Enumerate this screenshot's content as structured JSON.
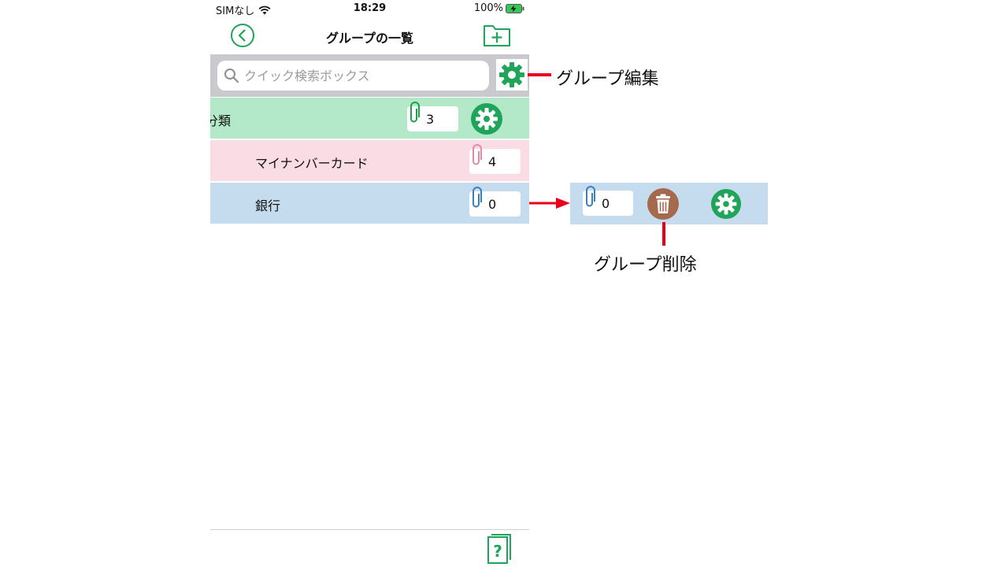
{
  "status_bar": {
    "carrier": "SIMなし",
    "time": "18:29",
    "battery": "100%"
  },
  "nav": {
    "title": "グループの一覧",
    "back_icon": "chevron-left-circle-icon",
    "add_icon": "folder-plus-icon"
  },
  "search": {
    "placeholder": "クイック検索ボックス",
    "value": ""
  },
  "groups": [
    {
      "label": "分類",
      "count": "3",
      "color": "#b3e8c8",
      "clip_color": "#1aa24e"
    },
    {
      "label": "マイナンバーカード",
      "count": "4",
      "color": "#f9dce4",
      "clip_color": "#e58aa5"
    },
    {
      "label": "銀行",
      "count": "0",
      "color": "#c5dcee",
      "clip_color": "#3a7fc0"
    }
  ],
  "detail": {
    "count": "0"
  },
  "annotations": {
    "group_edit": "グループ編集",
    "group_delete": "グループ削除"
  },
  "colors": {
    "accent_green": "#1ea55a",
    "delete_brown": "#a5694d",
    "annotation_red": "#e8001c"
  }
}
